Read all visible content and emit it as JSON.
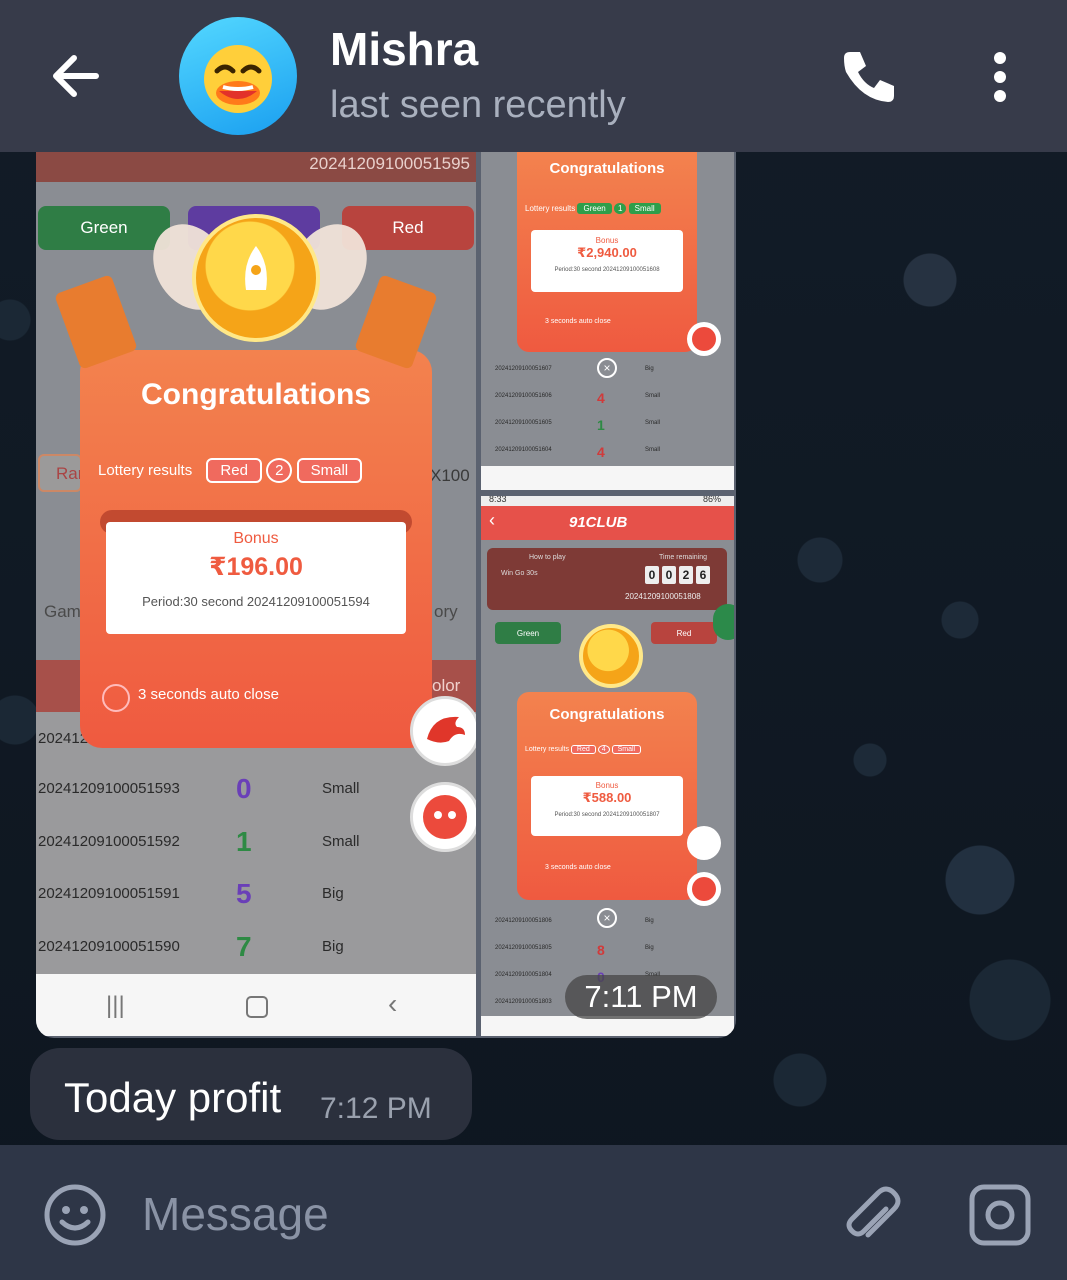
{
  "header": {
    "back_icon": "arrow-left-icon",
    "avatar_icon": "duck-emoji-avatar",
    "name": "Mishra",
    "status": "last seen recently",
    "call_icon": "phone-icon",
    "menu_icon": "more-vert-icon"
  },
  "album": {
    "timestamp": "7:11 PM",
    "shot_big": {
      "period_top": "20241209100051595",
      "btn_green": "Green",
      "btn_red": "Red",
      "popup_title": "Congratulations",
      "lottery_label": "Lottery results",
      "result_color": "Red",
      "result_number": "2",
      "result_size": "Small",
      "bonus_label": "Bonus",
      "bonus_amount": "₹196.00",
      "period_line": "Period:30 second 20241209100051594",
      "auto_close": "3 seconds auto close",
      "side_left_1": "Ran",
      "side_right_1": "X100",
      "side_left_2": "Gam",
      "side_right_2": "ory",
      "side_right_3": "olor",
      "row_partial": "202412",
      "rows": [
        {
          "period": "20241209100051593",
          "number": "0",
          "size": "Small"
        },
        {
          "period": "20241209100051592",
          "number": "1",
          "size": "Small"
        },
        {
          "period": "20241209100051591",
          "number": "5",
          "size": "Big"
        },
        {
          "period": "20241209100051590",
          "number": "7",
          "size": "Big"
        }
      ]
    },
    "shot_tr": {
      "popup_title": "Congratulations",
      "lottery_label": "Lottery results",
      "result_color": "Green",
      "result_number": "1",
      "result_size": "Small",
      "bonus_label": "Bonus",
      "bonus_amount": "₹2,940.00",
      "period_line": "Period:30 second 20241209100051608",
      "auto_close": "3 seconds auto close",
      "rows": [
        {
          "period": "20241209100051607",
          "number": "",
          "size": "Big"
        },
        {
          "period": "20241209100051606",
          "number": "4",
          "size": "Small"
        },
        {
          "period": "20241209100051605",
          "number": "1",
          "size": "Small"
        },
        {
          "period": "20241209100051604",
          "number": "4",
          "size": "Small"
        }
      ]
    },
    "shot_br": {
      "status_time": "8:33",
      "battery": "86%",
      "brand": "91CLUB",
      "how_to_play": "How to play",
      "win_go": "Win Go 30s",
      "time_remaining": "Time remaining",
      "timer": [
        "0",
        "0",
        "2",
        "6"
      ],
      "period_top": "20241209100051808",
      "btn_green": "Green",
      "btn_red": "Red",
      "popup_title": "Congratulations",
      "lottery_label": "Lottery results",
      "result_color": "Red",
      "result_number": "4",
      "result_size": "Small",
      "bonus_label": "Bonus",
      "bonus_amount": "₹588.00",
      "period_line": "Period:30 second 20241209100051807",
      "auto_close": "3 seconds auto close",
      "rows": [
        {
          "period": "20241209100051806",
          "number": "",
          "size": "Big"
        },
        {
          "period": "20241209100051805",
          "number": "8",
          "size": "Big"
        },
        {
          "period": "20241209100051804",
          "number": "0",
          "size": "Small"
        },
        {
          "period": "20241209100051803",
          "number": "",
          "size": ""
        }
      ]
    }
  },
  "message": {
    "text": "Today profit",
    "time": "7:12 PM"
  },
  "composer": {
    "emoji_icon": "emoji-icon",
    "placeholder": "Message",
    "attach_icon": "paperclip-icon",
    "camera_icon": "camera-icon"
  },
  "colors": {
    "header_bg": "#373b4a",
    "popup_orange": "#ef5a40",
    "green": "#2e9e4a",
    "red": "#e04848",
    "purple": "#7a4fd0"
  }
}
